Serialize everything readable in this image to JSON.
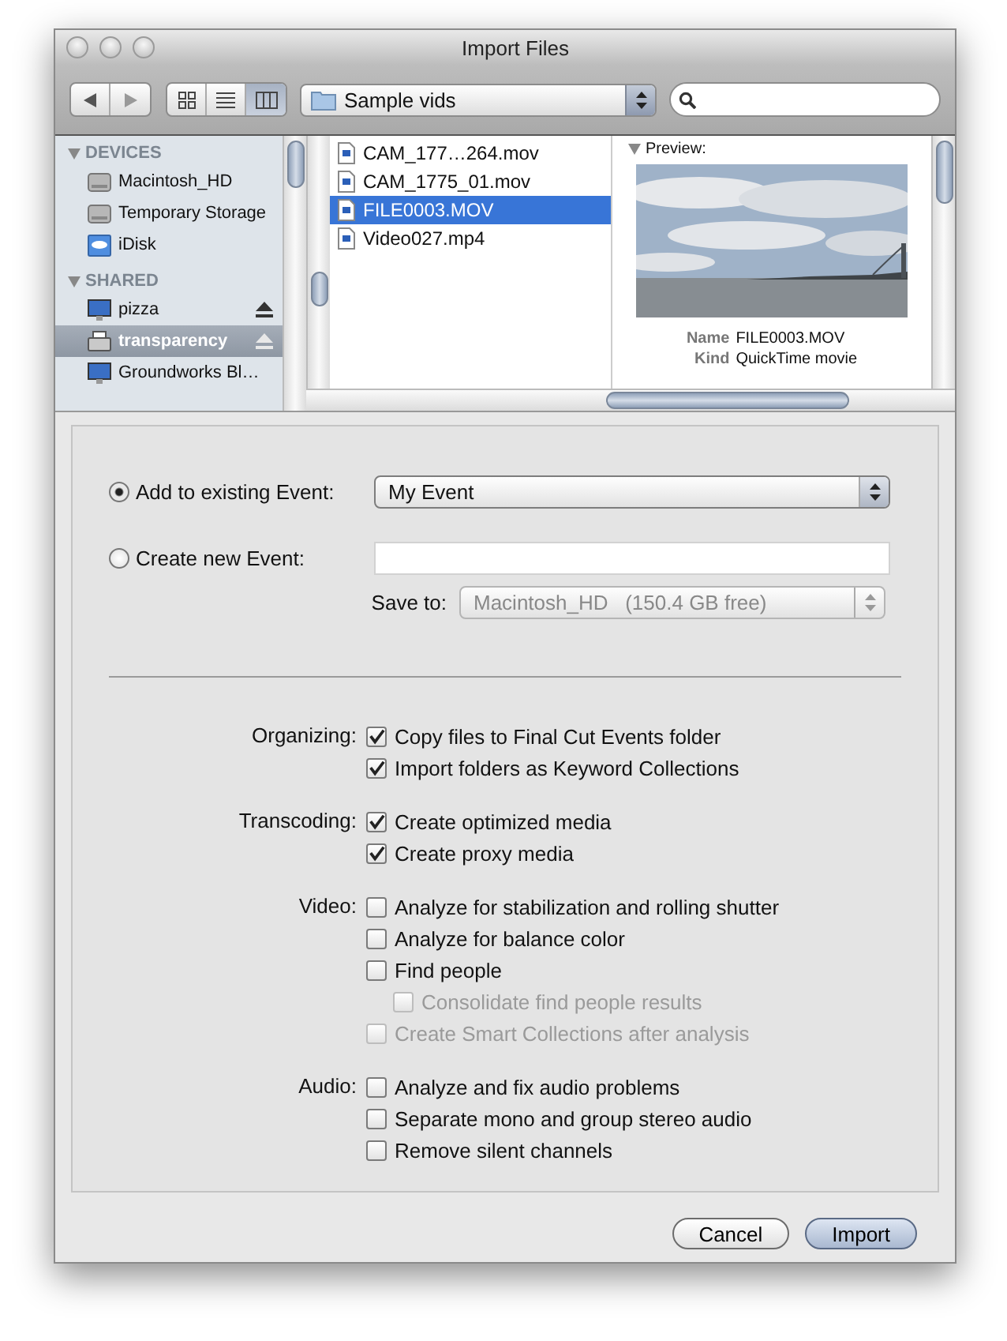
{
  "window": {
    "title": "Import Files"
  },
  "toolbar": {
    "view_modes": [
      {
        "kind": "icons",
        "selected": false
      },
      {
        "kind": "list",
        "selected": false
      },
      {
        "kind": "columns",
        "selected": true
      }
    ],
    "location": "Sample vids"
  },
  "sidebar": [
    {
      "title": "DEVICES",
      "items": [
        {
          "label": "Macintosh_HD",
          "kind": "drive",
          "selected": false,
          "eject": false
        },
        {
          "label": "Temporary Storage",
          "kind": "drive",
          "selected": false,
          "eject": false
        },
        {
          "label": "iDisk",
          "kind": "idisk",
          "selected": false,
          "eject": false
        }
      ]
    },
    {
      "title": "SHARED",
      "items": [
        {
          "label": "pizza",
          "kind": "computer",
          "selected": false,
          "eject": true
        },
        {
          "label": "transparency",
          "kind": "printer",
          "selected": true,
          "eject": true
        },
        {
          "label": "Groundworks Bl…",
          "kind": "computer",
          "selected": false,
          "eject": false
        }
      ]
    }
  ],
  "files": [
    {
      "name": "CAM_177…264.mov",
      "selected": false
    },
    {
      "name": "CAM_1775_01.mov",
      "selected": false
    },
    {
      "name": "FILE0003.MOV",
      "selected": true
    },
    {
      "name": "Video027.mp4",
      "selected": false
    }
  ],
  "preview": {
    "heading": "Preview:",
    "fields": [
      {
        "label": "Name",
        "value": "FILE0003.MOV"
      },
      {
        "label": "Kind",
        "value": "QuickTime movie"
      }
    ]
  },
  "event": {
    "options": [
      {
        "label": "Add to existing Event:",
        "selected": true,
        "kind": "popup",
        "value": "My Event"
      },
      {
        "label": "Create new Event:",
        "selected": false,
        "kind": "field"
      }
    ],
    "save_to": {
      "label": "Save to:",
      "value": "Macintosh_HD   (150.4 GB free)",
      "disabled": true
    }
  },
  "groups": [
    {
      "label": "Organizing:",
      "options": [
        {
          "label": "Copy files to Final Cut Events folder",
          "checked": true,
          "disabled": false
        },
        {
          "label": "Import folders as Keyword Collections",
          "checked": true,
          "disabled": false
        }
      ]
    },
    {
      "label": "Transcoding:",
      "options": [
        {
          "label": "Create optimized media",
          "checked": true,
          "disabled": false
        },
        {
          "label": "Create proxy media",
          "checked": true,
          "disabled": false
        }
      ]
    },
    {
      "label": "Video:",
      "options": [
        {
          "label": "Analyze for stabilization and rolling shutter",
          "checked": false,
          "disabled": false
        },
        {
          "label": "Analyze for balance color",
          "checked": false,
          "disabled": false
        },
        {
          "label": "Find people",
          "checked": false,
          "disabled": false,
          "children": [
            {
              "label": "Consolidate find people results",
              "checked": false,
              "disabled": true
            }
          ]
        },
        {
          "label": "Create Smart Collections after analysis",
          "checked": false,
          "disabled": true
        }
      ]
    },
    {
      "label": "Audio:",
      "options": [
        {
          "label": "Analyze and fix audio problems",
          "checked": false,
          "disabled": false
        },
        {
          "label": "Separate mono and group stereo audio",
          "checked": false,
          "disabled": false
        },
        {
          "label": "Remove silent channels",
          "checked": false,
          "disabled": false
        }
      ]
    }
  ],
  "buttons": [
    {
      "label": "Cancel",
      "default": false
    },
    {
      "label": "Import",
      "default": true
    }
  ]
}
